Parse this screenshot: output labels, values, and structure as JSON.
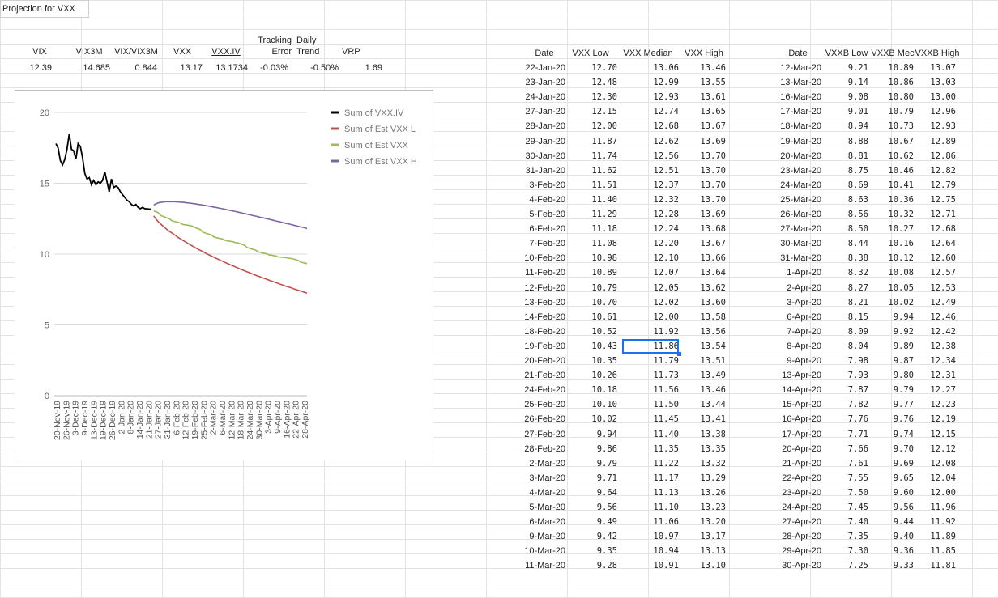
{
  "sheet": {
    "title": "Projection for VXX"
  },
  "summary": {
    "headers": [
      "VIX",
      "VIX3M",
      "VIX/VIX3M",
      "VXX",
      "VXX.IV",
      "Tracking\nError",
      "Daily\nTrend",
      "VRP"
    ],
    "values": [
      "12.39",
      "14.685",
      "0.844",
      "13.17",
      "13.1734",
      "-0.03%",
      "-0.50%",
      "1.69"
    ]
  },
  "table_vxx": {
    "headers": [
      "Date",
      "VXX Low",
      "VXX Median",
      "VXX High"
    ],
    "rows": [
      [
        "22-Jan-20",
        "12.70",
        "13.06",
        "13.46"
      ],
      [
        "23-Jan-20",
        "12.48",
        "12.99",
        "13.55"
      ],
      [
        "24-Jan-20",
        "12.30",
        "12.93",
        "13.61"
      ],
      [
        "27-Jan-20",
        "12.15",
        "12.74",
        "13.65"
      ],
      [
        "28-Jan-20",
        "12.00",
        "12.68",
        "13.67"
      ],
      [
        "29-Jan-20",
        "11.87",
        "12.62",
        "13.69"
      ],
      [
        "30-Jan-20",
        "11.74",
        "12.56",
        "13.70"
      ],
      [
        "31-Jan-20",
        "11.62",
        "12.51",
        "13.70"
      ],
      [
        "3-Feb-20",
        "11.51",
        "12.37",
        "13.70"
      ],
      [
        "4-Feb-20",
        "11.40",
        "12.32",
        "13.70"
      ],
      [
        "5-Feb-20",
        "11.29",
        "12.28",
        "13.69"
      ],
      [
        "6-Feb-20",
        "11.18",
        "12.24",
        "13.68"
      ],
      [
        "7-Feb-20",
        "11.08",
        "12.20",
        "13.67"
      ],
      [
        "10-Feb-20",
        "10.98",
        "12.10",
        "13.66"
      ],
      [
        "11-Feb-20",
        "10.89",
        "12.07",
        "13.64"
      ],
      [
        "12-Feb-20",
        "10.79",
        "12.05",
        "13.62"
      ],
      [
        "13-Feb-20",
        "10.70",
        "12.02",
        "13.60"
      ],
      [
        "14-Feb-20",
        "10.61",
        "12.00",
        "13.58"
      ],
      [
        "18-Feb-20",
        "10.52",
        "11.92",
        "13.56"
      ],
      [
        "19-Feb-20",
        "10.43",
        "11.86",
        "13.54"
      ],
      [
        "20-Feb-20",
        "10.35",
        "11.79",
        "13.51"
      ],
      [
        "21-Feb-20",
        "10.26",
        "11.73",
        "13.49"
      ],
      [
        "24-Feb-20",
        "10.18",
        "11.56",
        "13.46"
      ],
      [
        "25-Feb-20",
        "10.10",
        "11.50",
        "13.44"
      ],
      [
        "26-Feb-20",
        "10.02",
        "11.45",
        "13.41"
      ],
      [
        "27-Feb-20",
        "9.94",
        "11.40",
        "13.38"
      ],
      [
        "28-Feb-20",
        "9.86",
        "11.35",
        "13.35"
      ],
      [
        "2-Mar-20",
        "9.79",
        "11.22",
        "13.32"
      ],
      [
        "3-Mar-20",
        "9.71",
        "11.17",
        "13.29"
      ],
      [
        "4-Mar-20",
        "9.64",
        "11.13",
        "13.26"
      ],
      [
        "5-Mar-20",
        "9.56",
        "11.10",
        "13.23"
      ],
      [
        "6-Mar-20",
        "9.49",
        "11.06",
        "13.20"
      ],
      [
        "9-Mar-20",
        "9.42",
        "10.97",
        "13.17"
      ],
      [
        "10-Mar-20",
        "9.35",
        "10.94",
        "13.13"
      ],
      [
        "11-Mar-20",
        "9.28",
        "10.91",
        "13.10"
      ]
    ],
    "selected_row": 19,
    "selected_col": 2
  },
  "table_vxxb": {
    "headers": [
      "Date",
      "VXXB Low",
      "VXXB Mec",
      "VXXB High"
    ],
    "rows": [
      [
        "12-Mar-20",
        "9.21",
        "10.89",
        "13.07"
      ],
      [
        "13-Mar-20",
        "9.14",
        "10.86",
        "13.03"
      ],
      [
        "16-Mar-20",
        "9.08",
        "10.80",
        "13.00"
      ],
      [
        "17-Mar-20",
        "9.01",
        "10.79",
        "12.96"
      ],
      [
        "18-Mar-20",
        "8.94",
        "10.73",
        "12.93"
      ],
      [
        "19-Mar-20",
        "8.88",
        "10.67",
        "12.89"
      ],
      [
        "20-Mar-20",
        "8.81",
        "10.62",
        "12.86"
      ],
      [
        "23-Mar-20",
        "8.75",
        "10.46",
        "12.82"
      ],
      [
        "24-Mar-20",
        "8.69",
        "10.41",
        "12.79"
      ],
      [
        "25-Mar-20",
        "8.63",
        "10.36",
        "12.75"
      ],
      [
        "26-Mar-20",
        "8.56",
        "10.32",
        "12.71"
      ],
      [
        "27-Mar-20",
        "8.50",
        "10.27",
        "12.68"
      ],
      [
        "30-Mar-20",
        "8.44",
        "10.16",
        "12.64"
      ],
      [
        "31-Mar-20",
        "8.38",
        "10.12",
        "12.60"
      ],
      [
        "1-Apr-20",
        "8.32",
        "10.08",
        "12.57"
      ],
      [
        "2-Apr-20",
        "8.27",
        "10.05",
        "12.53"
      ],
      [
        "3-Apr-20",
        "8.21",
        "10.02",
        "12.49"
      ],
      [
        "6-Apr-20",
        "8.15",
        "9.94",
        "12.46"
      ],
      [
        "7-Apr-20",
        "8.09",
        "9.92",
        "12.42"
      ],
      [
        "8-Apr-20",
        "8.04",
        "9.89",
        "12.38"
      ],
      [
        "9-Apr-20",
        "7.98",
        "9.87",
        "12.34"
      ],
      [
        "13-Apr-20",
        "7.93",
        "9.80",
        "12.31"
      ],
      [
        "14-Apr-20",
        "7.87",
        "9.79",
        "12.27"
      ],
      [
        "15-Apr-20",
        "7.82",
        "9.77",
        "12.23"
      ],
      [
        "16-Apr-20",
        "7.76",
        "9.76",
        "12.19"
      ],
      [
        "17-Apr-20",
        "7.71",
        "9.74",
        "12.15"
      ],
      [
        "20-Apr-20",
        "7.66",
        "9.70",
        "12.12"
      ],
      [
        "21-Apr-20",
        "7.61",
        "9.69",
        "12.08"
      ],
      [
        "22-Apr-20",
        "7.55",
        "9.65",
        "12.04"
      ],
      [
        "23-Apr-20",
        "7.50",
        "9.60",
        "12.00"
      ],
      [
        "24-Apr-20",
        "7.45",
        "9.56",
        "11.96"
      ],
      [
        "27-Apr-20",
        "7.40",
        "9.44",
        "11.92"
      ],
      [
        "28-Apr-20",
        "7.35",
        "9.40",
        "11.89"
      ],
      [
        "29-Apr-20",
        "7.30",
        "9.36",
        "11.85"
      ],
      [
        "30-Apr-20",
        "7.25",
        "9.33",
        "11.81"
      ]
    ]
  },
  "chart_data": {
    "type": "line",
    "title": "",
    "xlabel": "",
    "ylabel": "",
    "ylim": [
      0,
      20
    ],
    "yticks": [
      0,
      5,
      10,
      15,
      20
    ],
    "grid": true,
    "legend": "top-right",
    "x_ticks": [
      "20-Nov-19",
      "26-Nov-19",
      "3-Dec-19",
      "9-Dec-19",
      "13-Dec-19",
      "19-Dec-19",
      "26-Dec-19",
      "2-Jan-20",
      "8-Jan-20",
      "14-Jan-20",
      "21-Jan-20",
      "27-Jan-20",
      "31-Jan-20",
      "6-Feb-20",
      "12-Feb-20",
      "19-Feb-20",
      "25-Feb-20",
      "2-Mar-20",
      "6-Mar-20",
      "12-Mar-20",
      "18-Mar-20",
      "24-Mar-20",
      "30-Mar-20",
      "3-Apr-20",
      "9-Apr-20",
      "16-Apr-20",
      "22-Apr-20",
      "28-Apr-20"
    ],
    "series": [
      {
        "name": "Sum of VXX.IV",
        "color": "#000000",
        "x_index": [
          0,
          1,
          2,
          3,
          4,
          5,
          6,
          7,
          8,
          9,
          10,
          11,
          12,
          13,
          14,
          15,
          16,
          17,
          18,
          19,
          20,
          21,
          22,
          23,
          24,
          25,
          26,
          27,
          28,
          29,
          30,
          31,
          32,
          33,
          34,
          35,
          36,
          37,
          38,
          39,
          40,
          41,
          42,
          43
        ],
        "values": [
          17.8,
          17.5,
          16.6,
          16.3,
          16.7,
          17.4,
          18.5,
          17.4,
          17.3,
          16.7,
          17.8,
          17.6,
          16.8,
          15.7,
          15.3,
          15.4,
          14.9,
          15.2,
          14.9,
          15.1,
          15.0,
          15.2,
          15.8,
          15.1,
          14.4,
          15.3,
          14.7,
          14.8,
          14.7,
          14.4,
          14.2,
          14.0,
          13.8,
          13.7,
          13.5,
          13.4,
          13.5,
          13.3,
          13.2,
          13.3,
          13.2,
          13.2,
          13.17,
          13.17
        ]
      },
      {
        "name": "Sum of Est VXX L",
        "color": "#c0504d",
        "values_from": "table_vxx+table_vxxb:low"
      },
      {
        "name": "Sum of Est VXX",
        "color": "#9bbb59",
        "values_from": "table_vxx+table_vxxb:median"
      },
      {
        "name": "Sum of Est VXX H",
        "color": "#8064a2",
        "values_from": "table_vxx+table_vxxb:high"
      }
    ]
  }
}
